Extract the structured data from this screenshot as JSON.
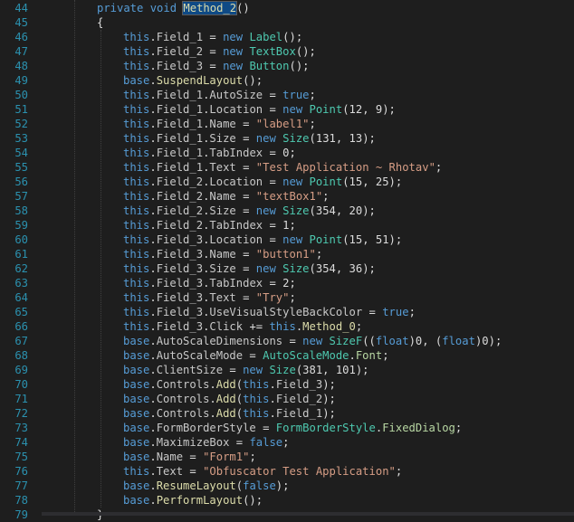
{
  "theme": {
    "background": "#1e1e1e",
    "keyword": "#569cd6",
    "string": "#d69d85",
    "type": "#4ec9b0",
    "method": "#dcdcaa",
    "line_number": "#2b91af"
  },
  "lines": [
    {
      "n": "44",
      "tokens": [
        [
          "kw",
          "private "
        ],
        [
          "kw",
          "void "
        ],
        [
          "hl",
          "Method_2"
        ],
        [
          "p",
          "()"
        ]
      ]
    },
    {
      "n": "45",
      "tokens": [
        [
          "p",
          "{"
        ]
      ]
    },
    {
      "n": "46",
      "tokens": [
        [
          "kw",
          "this"
        ],
        [
          "p",
          "."
        ],
        [
          "fld",
          "Field_1"
        ],
        [
          "p",
          " = "
        ],
        [
          "kw",
          "new "
        ],
        [
          "typ",
          "Label"
        ],
        [
          "p",
          "();"
        ]
      ]
    },
    {
      "n": "47",
      "tokens": [
        [
          "kw",
          "this"
        ],
        [
          "p",
          "."
        ],
        [
          "fld",
          "Field_2"
        ],
        [
          "p",
          " = "
        ],
        [
          "kw",
          "new "
        ],
        [
          "typ",
          "TextBox"
        ],
        [
          "p",
          "();"
        ]
      ]
    },
    {
      "n": "48",
      "tokens": [
        [
          "kw",
          "this"
        ],
        [
          "p",
          "."
        ],
        [
          "fld",
          "Field_3"
        ],
        [
          "p",
          " = "
        ],
        [
          "kw",
          "new "
        ],
        [
          "typ",
          "Button"
        ],
        [
          "p",
          "();"
        ]
      ]
    },
    {
      "n": "49",
      "tokens": [
        [
          "kw",
          "base"
        ],
        [
          "p",
          "."
        ],
        [
          "mth",
          "SuspendLayout"
        ],
        [
          "p",
          "();"
        ]
      ]
    },
    {
      "n": "50",
      "tokens": [
        [
          "kw",
          "this"
        ],
        [
          "p",
          "."
        ],
        [
          "fld",
          "Field_1"
        ],
        [
          "p",
          "."
        ],
        [
          "mem",
          "AutoSize"
        ],
        [
          "p",
          " = "
        ],
        [
          "kw",
          "true"
        ],
        [
          "p",
          ";"
        ]
      ]
    },
    {
      "n": "51",
      "tokens": [
        [
          "kw",
          "this"
        ],
        [
          "p",
          "."
        ],
        [
          "fld",
          "Field_1"
        ],
        [
          "p",
          "."
        ],
        [
          "mem",
          "Location"
        ],
        [
          "p",
          " = "
        ],
        [
          "kw",
          "new "
        ],
        [
          "typ",
          "Point"
        ],
        [
          "p",
          "(12, 9);"
        ]
      ]
    },
    {
      "n": "52",
      "tokens": [
        [
          "kw",
          "this"
        ],
        [
          "p",
          "."
        ],
        [
          "fld",
          "Field_1"
        ],
        [
          "p",
          "."
        ],
        [
          "mem",
          "Name"
        ],
        [
          "p",
          " = "
        ],
        [
          "str",
          "\"label1\""
        ],
        [
          "p",
          ";"
        ]
      ]
    },
    {
      "n": "53",
      "tokens": [
        [
          "kw",
          "this"
        ],
        [
          "p",
          "."
        ],
        [
          "fld",
          "Field_1"
        ],
        [
          "p",
          "."
        ],
        [
          "mem",
          "Size"
        ],
        [
          "p",
          " = "
        ],
        [
          "kw",
          "new "
        ],
        [
          "typ",
          "Size"
        ],
        [
          "p",
          "(131, 13);"
        ]
      ]
    },
    {
      "n": "54",
      "tokens": [
        [
          "kw",
          "this"
        ],
        [
          "p",
          "."
        ],
        [
          "fld",
          "Field_1"
        ],
        [
          "p",
          "."
        ],
        [
          "mem",
          "TabIndex"
        ],
        [
          "p",
          " = 0;"
        ]
      ]
    },
    {
      "n": "55",
      "tokens": [
        [
          "kw",
          "this"
        ],
        [
          "p",
          "."
        ],
        [
          "fld",
          "Field_1"
        ],
        [
          "p",
          "."
        ],
        [
          "mem",
          "Text"
        ],
        [
          "p",
          " = "
        ],
        [
          "str",
          "\"Test Application ~ Rhotav\""
        ],
        [
          "p",
          ";"
        ]
      ]
    },
    {
      "n": "56",
      "tokens": [
        [
          "kw",
          "this"
        ],
        [
          "p",
          "."
        ],
        [
          "fld",
          "Field_2"
        ],
        [
          "p",
          "."
        ],
        [
          "mem",
          "Location"
        ],
        [
          "p",
          " = "
        ],
        [
          "kw",
          "new "
        ],
        [
          "typ",
          "Point"
        ],
        [
          "p",
          "(15, 25);"
        ]
      ]
    },
    {
      "n": "57",
      "tokens": [
        [
          "kw",
          "this"
        ],
        [
          "p",
          "."
        ],
        [
          "fld",
          "Field_2"
        ],
        [
          "p",
          "."
        ],
        [
          "mem",
          "Name"
        ],
        [
          "p",
          " = "
        ],
        [
          "str",
          "\"textBox1\""
        ],
        [
          "p",
          ";"
        ]
      ]
    },
    {
      "n": "58",
      "tokens": [
        [
          "kw",
          "this"
        ],
        [
          "p",
          "."
        ],
        [
          "fld",
          "Field_2"
        ],
        [
          "p",
          "."
        ],
        [
          "mem",
          "Size"
        ],
        [
          "p",
          " = "
        ],
        [
          "kw",
          "new "
        ],
        [
          "typ",
          "Size"
        ],
        [
          "p",
          "(354, 20);"
        ]
      ]
    },
    {
      "n": "59",
      "tokens": [
        [
          "kw",
          "this"
        ],
        [
          "p",
          "."
        ],
        [
          "fld",
          "Field_2"
        ],
        [
          "p",
          "."
        ],
        [
          "mem",
          "TabIndex"
        ],
        [
          "p",
          " = 1;"
        ]
      ]
    },
    {
      "n": "60",
      "tokens": [
        [
          "kw",
          "this"
        ],
        [
          "p",
          "."
        ],
        [
          "fld",
          "Field_3"
        ],
        [
          "p",
          "."
        ],
        [
          "mem",
          "Location"
        ],
        [
          "p",
          " = "
        ],
        [
          "kw",
          "new "
        ],
        [
          "typ",
          "Point"
        ],
        [
          "p",
          "(15, 51);"
        ]
      ]
    },
    {
      "n": "61",
      "tokens": [
        [
          "kw",
          "this"
        ],
        [
          "p",
          "."
        ],
        [
          "fld",
          "Field_3"
        ],
        [
          "p",
          "."
        ],
        [
          "mem",
          "Name"
        ],
        [
          "p",
          " = "
        ],
        [
          "str",
          "\"button1\""
        ],
        [
          "p",
          ";"
        ]
      ]
    },
    {
      "n": "62",
      "tokens": [
        [
          "kw",
          "this"
        ],
        [
          "p",
          "."
        ],
        [
          "fld",
          "Field_3"
        ],
        [
          "p",
          "."
        ],
        [
          "mem",
          "Size"
        ],
        [
          "p",
          " = "
        ],
        [
          "kw",
          "new "
        ],
        [
          "typ",
          "Size"
        ],
        [
          "p",
          "(354, 36);"
        ]
      ]
    },
    {
      "n": "63",
      "tokens": [
        [
          "kw",
          "this"
        ],
        [
          "p",
          "."
        ],
        [
          "fld",
          "Field_3"
        ],
        [
          "p",
          "."
        ],
        [
          "mem",
          "TabIndex"
        ],
        [
          "p",
          " = 2;"
        ]
      ]
    },
    {
      "n": "64",
      "tokens": [
        [
          "kw",
          "this"
        ],
        [
          "p",
          "."
        ],
        [
          "fld",
          "Field_3"
        ],
        [
          "p",
          "."
        ],
        [
          "mem",
          "Text"
        ],
        [
          "p",
          " = "
        ],
        [
          "str",
          "\"Try\""
        ],
        [
          "p",
          ";"
        ]
      ]
    },
    {
      "n": "65",
      "tokens": [
        [
          "kw",
          "this"
        ],
        [
          "p",
          "."
        ],
        [
          "fld",
          "Field_3"
        ],
        [
          "p",
          "."
        ],
        [
          "mem",
          "UseVisualStyleBackColor"
        ],
        [
          "p",
          " = "
        ],
        [
          "kw",
          "true"
        ],
        [
          "p",
          ";"
        ]
      ]
    },
    {
      "n": "66",
      "tokens": [
        [
          "kw",
          "this"
        ],
        [
          "p",
          "."
        ],
        [
          "fld",
          "Field_3"
        ],
        [
          "p",
          "."
        ],
        [
          "mem",
          "Click"
        ],
        [
          "p",
          " += "
        ],
        [
          "kw",
          "this"
        ],
        [
          "p",
          "."
        ],
        [
          "mth",
          "Method_0"
        ],
        [
          "p",
          ";"
        ]
      ]
    },
    {
      "n": "67",
      "tokens": [
        [
          "kw",
          "base"
        ],
        [
          "p",
          "."
        ],
        [
          "mem",
          "AutoScaleDimensions"
        ],
        [
          "p",
          " = "
        ],
        [
          "kw",
          "new "
        ],
        [
          "typ",
          "SizeF"
        ],
        [
          "p",
          "(("
        ],
        [
          "kw",
          "float"
        ],
        [
          "p",
          ")0, ("
        ],
        [
          "kw",
          "float"
        ],
        [
          "p",
          ")0);"
        ]
      ]
    },
    {
      "n": "68",
      "tokens": [
        [
          "kw",
          "base"
        ],
        [
          "p",
          "."
        ],
        [
          "mem",
          "AutoScaleMode"
        ],
        [
          "p",
          " = "
        ],
        [
          "typ",
          "AutoScaleMode"
        ],
        [
          "p",
          "."
        ],
        [
          "pur",
          "Font"
        ],
        [
          "p",
          ";"
        ]
      ]
    },
    {
      "n": "69",
      "tokens": [
        [
          "kw",
          "base"
        ],
        [
          "p",
          "."
        ],
        [
          "mem",
          "ClientSize"
        ],
        [
          "p",
          " = "
        ],
        [
          "kw",
          "new "
        ],
        [
          "typ",
          "Size"
        ],
        [
          "p",
          "(381, 101);"
        ]
      ]
    },
    {
      "n": "70",
      "tokens": [
        [
          "kw",
          "base"
        ],
        [
          "p",
          "."
        ],
        [
          "mem",
          "Controls"
        ],
        [
          "p",
          "."
        ],
        [
          "mth",
          "Add"
        ],
        [
          "p",
          "("
        ],
        [
          "kw",
          "this"
        ],
        [
          "p",
          "."
        ],
        [
          "fld",
          "Field_3"
        ],
        [
          "p",
          ");"
        ]
      ]
    },
    {
      "n": "71",
      "tokens": [
        [
          "kw",
          "base"
        ],
        [
          "p",
          "."
        ],
        [
          "mem",
          "Controls"
        ],
        [
          "p",
          "."
        ],
        [
          "mth",
          "Add"
        ],
        [
          "p",
          "("
        ],
        [
          "kw",
          "this"
        ],
        [
          "p",
          "."
        ],
        [
          "fld",
          "Field_2"
        ],
        [
          "p",
          ");"
        ]
      ]
    },
    {
      "n": "72",
      "tokens": [
        [
          "kw",
          "base"
        ],
        [
          "p",
          "."
        ],
        [
          "mem",
          "Controls"
        ],
        [
          "p",
          "."
        ],
        [
          "mth",
          "Add"
        ],
        [
          "p",
          "("
        ],
        [
          "kw",
          "this"
        ],
        [
          "p",
          "."
        ],
        [
          "fld",
          "Field_1"
        ],
        [
          "p",
          ");"
        ]
      ]
    },
    {
      "n": "73",
      "tokens": [
        [
          "kw",
          "base"
        ],
        [
          "p",
          "."
        ],
        [
          "mem",
          "FormBorderStyle"
        ],
        [
          "p",
          " = "
        ],
        [
          "typ",
          "FormBorderStyle"
        ],
        [
          "p",
          "."
        ],
        [
          "pur",
          "FixedDialog"
        ],
        [
          "p",
          ";"
        ]
      ]
    },
    {
      "n": "74",
      "tokens": [
        [
          "kw",
          "base"
        ],
        [
          "p",
          "."
        ],
        [
          "mem",
          "MaximizeBox"
        ],
        [
          "p",
          " = "
        ],
        [
          "kw",
          "false"
        ],
        [
          "p",
          ";"
        ]
      ]
    },
    {
      "n": "75",
      "tokens": [
        [
          "kw",
          "base"
        ],
        [
          "p",
          "."
        ],
        [
          "mem",
          "Name"
        ],
        [
          "p",
          " = "
        ],
        [
          "str",
          "\"Form1\""
        ],
        [
          "p",
          ";"
        ]
      ]
    },
    {
      "n": "76",
      "tokens": [
        [
          "kw",
          "this"
        ],
        [
          "p",
          "."
        ],
        [
          "mem",
          "Text"
        ],
        [
          "p",
          " = "
        ],
        [
          "str",
          "\"Obfuscator Test Application\""
        ],
        [
          "p",
          ";"
        ]
      ]
    },
    {
      "n": "77",
      "tokens": [
        [
          "kw",
          "base"
        ],
        [
          "p",
          "."
        ],
        [
          "mth",
          "ResumeLayout"
        ],
        [
          "p",
          "("
        ],
        [
          "kw",
          "false"
        ],
        [
          "p",
          ");"
        ]
      ]
    },
    {
      "n": "78",
      "tokens": [
        [
          "kw",
          "base"
        ],
        [
          "p",
          "."
        ],
        [
          "mth",
          "PerformLayout"
        ],
        [
          "p",
          "();"
        ]
      ]
    },
    {
      "n": "79",
      "tokens": [
        [
          "p",
          "}"
        ]
      ]
    }
  ]
}
